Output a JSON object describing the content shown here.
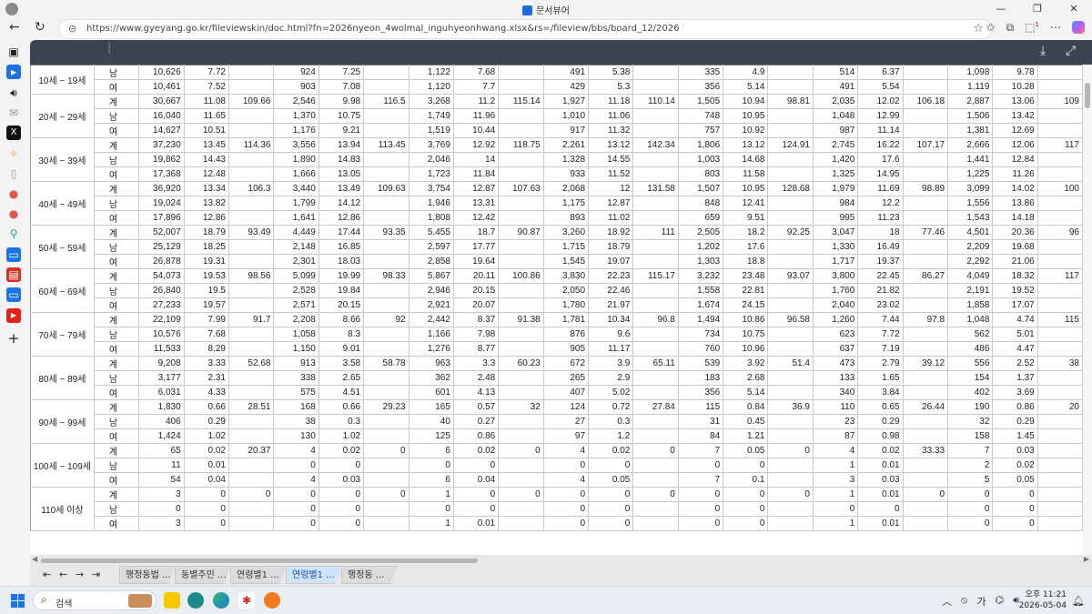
{
  "browser": {
    "window_title": "문서뷰어",
    "url": "https://www.gyeyang.go.kr/fileviewskin/doc.html?fn=2026nyeon_4wolmal_inguhyeonhwang.xlsx&rs=/fileview/bbs/board_12/2026",
    "window_buttons": [
      "—",
      "❐",
      "✕"
    ],
    "extension_badge": "1"
  },
  "sheet": {
    "groups": [
      {
        "age": "10세 ~ 19세",
        "rows": [
          {
            "sex": "남",
            "cells": [
              "10,626",
              "7.72",
              "",
              "924",
              "7.25",
              "",
              "1,122",
              "7.68",
              "",
              "491",
              "5.38",
              "",
              "335",
              "4.9",
              "",
              "514",
              "6.37",
              "",
              "1,098",
              "9.78",
              ""
            ]
          },
          {
            "sex": "여",
            "cells": [
              "10,461",
              "7.52",
              "",
              "903",
              "7.08",
              "",
              "1,120",
              "7.7",
              "",
              "429",
              "5.3",
              "",
              "356",
              "5.14",
              "",
              "491",
              "5.54",
              "",
              "1,119",
              "10.28",
              ""
            ]
          }
        ]
      },
      {
        "age": "20세 ~ 29세",
        "rows": [
          {
            "sex": "계",
            "cells": [
              "30,667",
              "11.08",
              "109.66",
              "2,546",
              "9.98",
              "116.5",
              "3,268",
              "11.2",
              "115.14",
              "1,927",
              "11.18",
              "110.14",
              "1,505",
              "10.94",
              "98.81",
              "2,035",
              "12.02",
              "106.18",
              "2,887",
              "13.06",
              "109"
            ]
          },
          {
            "sex": "남",
            "cells": [
              "16,040",
              "11.65",
              "",
              "1,370",
              "10.75",
              "",
              "1,749",
              "11.96",
              "",
              "1,010",
              "11.06",
              "",
              "748",
              "10.95",
              "",
              "1,048",
              "12.99",
              "",
              "1,506",
              "13.42",
              ""
            ]
          },
          {
            "sex": "여",
            "cells": [
              "14,627",
              "10.51",
              "",
              "1,176",
              "9.21",
              "",
              "1,519",
              "10.44",
              "",
              "917",
              "11.32",
              "",
              "757",
              "10.92",
              "",
              "987",
              "11.14",
              "",
              "1,381",
              "12.69",
              ""
            ]
          }
        ]
      },
      {
        "age": "30세 ~ 39세",
        "rows": [
          {
            "sex": "계",
            "cells": [
              "37,230",
              "13.45",
              "114.36",
              "3,556",
              "13.94",
              "113.45",
              "3,769",
              "12.92",
              "118.75",
              "2,261",
              "13.12",
              "142.34",
              "1,806",
              "13.12",
              "124.91",
              "2,745",
              "16.22",
              "107.17",
              "2,666",
              "12.06",
              "117"
            ]
          },
          {
            "sex": "남",
            "cells": [
              "19,862",
              "14.43",
              "",
              "1,890",
              "14.83",
              "",
              "2,046",
              "14",
              "",
              "1,328",
              "14.55",
              "",
              "1,003",
              "14.68",
              "",
              "1,420",
              "17.6",
              "",
              "1,441",
              "12.84",
              ""
            ]
          },
          {
            "sex": "여",
            "cells": [
              "17,368",
              "12.48",
              "",
              "1,666",
              "13.05",
              "",
              "1,723",
              "11.84",
              "",
              "933",
              "11.52",
              "",
              "803",
              "11.58",
              "",
              "1,325",
              "14.95",
              "",
              "1,225",
              "11.26",
              ""
            ]
          }
        ]
      },
      {
        "age": "40세 ~ 49세",
        "rows": [
          {
            "sex": "계",
            "cells": [
              "36,920",
              "13.34",
              "106.3",
              "3,440",
              "13.49",
              "109.63",
              "3,754",
              "12.87",
              "107.63",
              "2,068",
              "12",
              "131.58",
              "1,507",
              "10.95",
              "128.68",
              "1,979",
              "11.69",
              "98.89",
              "3,099",
              "14.02",
              "100"
            ]
          },
          {
            "sex": "남",
            "cells": [
              "19,024",
              "13.82",
              "",
              "1,799",
              "14.12",
              "",
              "1,946",
              "13.31",
              "",
              "1,175",
              "12.87",
              "",
              "848",
              "12.41",
              "",
              "984",
              "12.2",
              "",
              "1,556",
              "13.86",
              ""
            ]
          },
          {
            "sex": "여",
            "cells": [
              "17,896",
              "12.86",
              "",
              "1,641",
              "12.86",
              "",
              "1,808",
              "12.42",
              "",
              "893",
              "11.02",
              "",
              "659",
              "9.51",
              "",
              "995",
              "11.23",
              "",
              "1,543",
              "14.18",
              ""
            ]
          }
        ]
      },
      {
        "age": "50세 ~ 59세",
        "rows": [
          {
            "sex": "계",
            "cells": [
              "52,007",
              "18.79",
              "93.49",
              "4,449",
              "17.44",
              "93.35",
              "5,455",
              "18.7",
              "90.87",
              "3,260",
              "18.92",
              "111",
              "2,505",
              "18.2",
              "92.25",
              "3,047",
              "18",
              "77.46",
              "4,501",
              "20.36",
              "96"
            ]
          },
          {
            "sex": "남",
            "cells": [
              "25,129",
              "18.25",
              "",
              "2,148",
              "16.85",
              "",
              "2,597",
              "17.77",
              "",
              "1,715",
              "18.79",
              "",
              "1,202",
              "17.6",
              "",
              "1,330",
              "16.49",
              "",
              "2,209",
              "19.68",
              ""
            ]
          },
          {
            "sex": "여",
            "cells": [
              "26,878",
              "19.31",
              "",
              "2,301",
              "18.03",
              "",
              "2,858",
              "19.64",
              "",
              "1,545",
              "19.07",
              "",
              "1,303",
              "18.8",
              "",
              "1,717",
              "19.37",
              "",
              "2,292",
              "21.06",
              ""
            ]
          }
        ]
      },
      {
        "age": "60세 ~ 69세",
        "rows": [
          {
            "sex": "계",
            "cells": [
              "54,073",
              "19.53",
              "98.56",
              "5,099",
              "19.99",
              "98.33",
              "5,867",
              "20.11",
              "100.86",
              "3,830",
              "22.23",
              "115.17",
              "3,232",
              "23.48",
              "93.07",
              "3,800",
              "22.45",
              "86.27",
              "4,049",
              "18.32",
              "117"
            ]
          },
          {
            "sex": "남",
            "cells": [
              "26,840",
              "19.5",
              "",
              "2,528",
              "19.84",
              "",
              "2,946",
              "20.15",
              "",
              "2,050",
              "22.46",
              "",
              "1,558",
              "22.81",
              "",
              "1,760",
              "21.82",
              "",
              "2,191",
              "19.52",
              ""
            ]
          },
          {
            "sex": "여",
            "cells": [
              "27,233",
              "19.57",
              "",
              "2,571",
              "20.15",
              "",
              "2,921",
              "20.07",
              "",
              "1,780",
              "21.97",
              "",
              "1,674",
              "24.15",
              "",
              "2,040",
              "23.02",
              "",
              "1,858",
              "17.07",
              ""
            ]
          }
        ]
      },
      {
        "age": "70세 ~ 79세",
        "rows": [
          {
            "sex": "계",
            "cells": [
              "22,109",
              "7.99",
              "91.7",
              "2,208",
              "8.66",
              "92",
              "2,442",
              "8.37",
              "91.38",
              "1,781",
              "10.34",
              "96.8",
              "1,494",
              "10.86",
              "96.58",
              "1,260",
              "7.44",
              "97.8",
              "1,048",
              "4.74",
              "115"
            ]
          },
          {
            "sex": "남",
            "cells": [
              "10,576",
              "7.68",
              "",
              "1,058",
              "8.3",
              "",
              "1,166",
              "7.98",
              "",
              "876",
              "9.6",
              "",
              "734",
              "10.75",
              "",
              "623",
              "7.72",
              "",
              "562",
              "5.01",
              ""
            ]
          },
          {
            "sex": "여",
            "cells": [
              "11,533",
              "8.29",
              "",
              "1,150",
              "9.01",
              "",
              "1,276",
              "8.77",
              "",
              "905",
              "11.17",
              "",
              "760",
              "10.96",
              "",
              "637",
              "7.19",
              "",
              "486",
              "4.47",
              ""
            ]
          }
        ]
      },
      {
        "age": "80세 ~ 89세",
        "rows": [
          {
            "sex": "계",
            "cells": [
              "9,208",
              "3.33",
              "52.68",
              "913",
              "3.58",
              "58.78",
              "963",
              "3.3",
              "60.23",
              "672",
              "3.9",
              "65.11",
              "539",
              "3.92",
              "51.4",
              "473",
              "2.79",
              "39.12",
              "556",
              "2.52",
              "38"
            ]
          },
          {
            "sex": "남",
            "cells": [
              "3,177",
              "2.31",
              "",
              "338",
              "2.65",
              "",
              "362",
              "2.48",
              "",
              "265",
              "2.9",
              "",
              "183",
              "2.68",
              "",
              "133",
              "1.65",
              "",
              "154",
              "1.37",
              ""
            ]
          },
          {
            "sex": "여",
            "cells": [
              "6,031",
              "4.33",
              "",
              "575",
              "4.51",
              "",
              "601",
              "4.13",
              "",
              "407",
              "5.02",
              "",
              "356",
              "5.14",
              "",
              "340",
              "3.84",
              "",
              "402",
              "3.69",
              ""
            ]
          }
        ]
      },
      {
        "age": "90세 ~ 99세",
        "rows": [
          {
            "sex": "계",
            "cells": [
              "1,830",
              "0.66",
              "28.51",
              "168",
              "0.66",
              "29.23",
              "165",
              "0.57",
              "32",
              "124",
              "0.72",
              "27.84",
              "115",
              "0.84",
              "36.9",
              "110",
              "0.65",
              "26.44",
              "190",
              "0.86",
              "20"
            ]
          },
          {
            "sex": "남",
            "cells": [
              "406",
              "0.29",
              "",
              "38",
              "0.3",
              "",
              "40",
              "0.27",
              "",
              "27",
              "0.3",
              "",
              "31",
              "0.45",
              "",
              "23",
              "0.29",
              "",
              "32",
              "0.29",
              ""
            ]
          },
          {
            "sex": "여",
            "cells": [
              "1,424",
              "1.02",
              "",
              "130",
              "1.02",
              "",
              "125",
              "0.86",
              "",
              "97",
              "1.2",
              "",
              "84",
              "1.21",
              "",
              "87",
              "0.98",
              "",
              "158",
              "1.45",
              ""
            ]
          }
        ]
      },
      {
        "age": "100세 ~ 109세",
        "rows": [
          {
            "sex": "계",
            "cells": [
              "65",
              "0.02",
              "20.37",
              "4",
              "0.02",
              "0",
              "6",
              "0.02",
              "0",
              "4",
              "0.02",
              "0",
              "7",
              "0.05",
              "0",
              "4",
              "0.02",
              "33.33",
              "7",
              "0.03",
              ""
            ]
          },
          {
            "sex": "남",
            "cells": [
              "11",
              "0.01",
              "",
              "0",
              "0",
              "",
              "0",
              "0",
              "",
              "0",
              "0",
              "",
              "0",
              "0",
              "",
              "1",
              "0.01",
              "",
              "2",
              "0.02",
              ""
            ]
          },
          {
            "sex": "여",
            "cells": [
              "54",
              "0.04",
              "",
              "4",
              "0.03",
              "",
              "6",
              "0.04",
              "",
              "4",
              "0.05",
              "",
              "7",
              "0.1",
              "",
              "3",
              "0.03",
              "",
              "5",
              "0.05",
              ""
            ]
          }
        ]
      },
      {
        "age": "110세 이상",
        "rows": [
          {
            "sex": "계",
            "cells": [
              "3",
              "0",
              "0",
              "0",
              "0",
              "0",
              "1",
              "0",
              "0",
              "0",
              "0",
              "0",
              "0",
              "0",
              "0",
              "1",
              "0.01",
              "0",
              "0",
              "0",
              ""
            ]
          },
          {
            "sex": "남",
            "cells": [
              "0",
              "0",
              "",
              "0",
              "0",
              "",
              "0",
              "0",
              "",
              "0",
              "0",
              "",
              "0",
              "0",
              "",
              "0",
              "0",
              "",
              "0",
              "0",
              ""
            ]
          },
          {
            "sex": "여",
            "cells": [
              "3",
              "0",
              "",
              "0",
              "0",
              "",
              "1",
              "0.01",
              "",
              "0",
              "0",
              "",
              "0",
              "0",
              "",
              "1",
              "0.01",
              "",
              "0",
              "0",
              ""
            ]
          }
        ]
      }
    ]
  },
  "sheet_tabs": [
    "행정동법 ...",
    "동별주민 ...",
    "연령별1 ...",
    "연령별1 ...",
    "행정동 ..."
  ],
  "active_tab_index": 3,
  "taskbar": {
    "search_placeholder": "검색",
    "ime": "가",
    "time": "오후 11:21",
    "date": "2026-05-04"
  }
}
